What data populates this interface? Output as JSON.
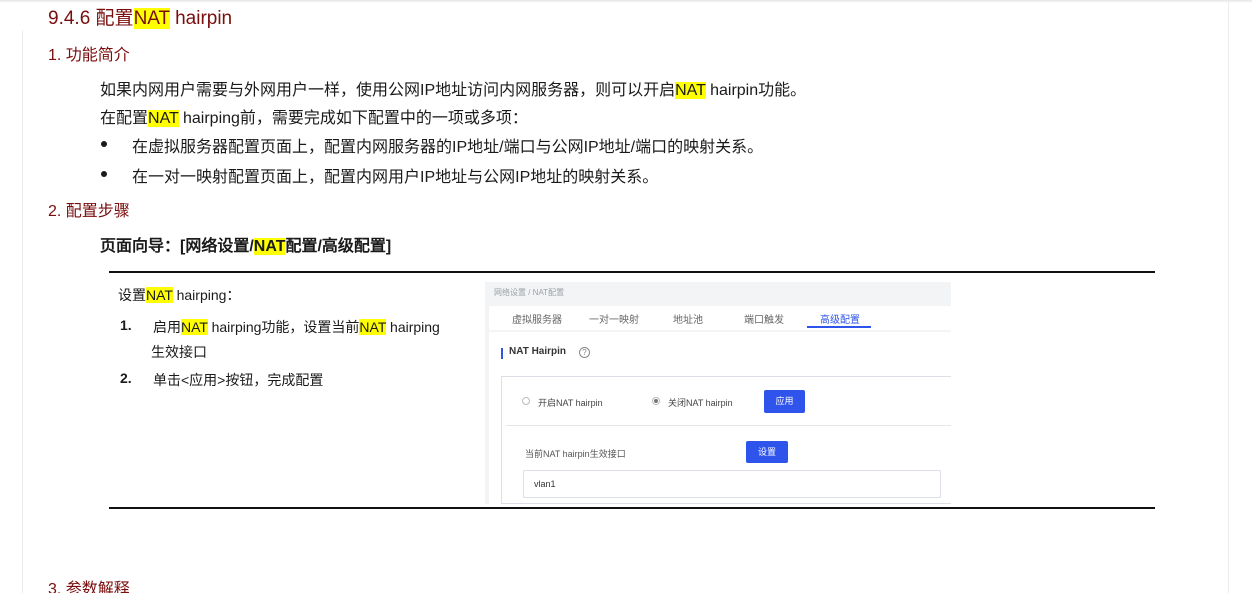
{
  "heading": {
    "num": "9.4.6 ",
    "pre": "配置",
    "hl": "NAT",
    "post": " hairpin"
  },
  "sec1": {
    "title": "1. 功能简介"
  },
  "intro": {
    "line1_pre": "如果内网用户需要与外网用户一样，使用公网IP地址访问内网服务器，则可以开启",
    "line1_hl": "NAT",
    "line1_post": " hairpin功能。",
    "line2_pre": "在配置",
    "line2_hl": "NAT",
    "line2_post": " hairping前，需要完成如下配置中的一项或多项：",
    "bullets": [
      "在虚拟服务器配置页面上，配置内网服务器的IP地址/端口与公网IP地址/端口的映射关系。",
      "在一对一映射配置页面上，配置内网用户IP地址与公网IP地址的映射关系。"
    ]
  },
  "sec2": {
    "title": "2. 配置步骤"
  },
  "nav": {
    "pre": "页面向导：[网络设置/",
    "hl": "NAT",
    "post": "配置/高级配置]"
  },
  "steps": {
    "title_pre": "设置",
    "title_hl": "NAT",
    "title_post": " hairping：",
    "s1_num": "1.",
    "s1_a": "启用",
    "s1_hl1": "NAT",
    "s1_b": " hairping功能，设置当前",
    "s1_hl2": "NAT",
    "s1_c": " hairping",
    "s1_d": "生效接口",
    "s2_num": "2.",
    "s2_text": "单击<应用>按钮，完成配置"
  },
  "screenshot": {
    "breadcrumb": "网络设置 / NAT配置",
    "tabs": [
      "虚拟服务器",
      "一对一映射",
      "地址池",
      "端口触发",
      "高级配置"
    ],
    "active_tab": "高级配置",
    "section_title": "NAT Hairpin",
    "help_icon": "question-circle-icon",
    "radio_on_label": "开启NAT hairpin",
    "radio_off_label": "关闭NAT hairpin",
    "selected_radio": "关闭NAT hairpin",
    "apply_label": "应用",
    "iface_label": "当前NAT hairpin生效接口",
    "set_label": "设置",
    "iface_value": "vlan1",
    "accent": "#2f54eb"
  },
  "sec3": {
    "title": "3. 参数解释"
  },
  "colors": {
    "heading": "#7a0d0d",
    "highlight": "#ffff00"
  }
}
